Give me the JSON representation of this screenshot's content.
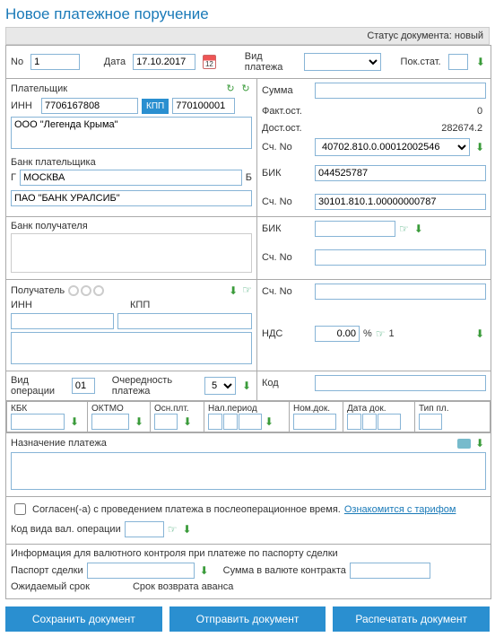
{
  "title": "Новое платежное поручение",
  "status": {
    "label": "Статус документа:",
    "value": "новый"
  },
  "header": {
    "no_label": "No",
    "no_value": "1",
    "date_label": "Дата",
    "date_value": "17.10.2017",
    "ptype_label": "Вид платежа",
    "pokstat_label": "Пок.стат."
  },
  "payer": {
    "label": "Плательщик",
    "inn_label": "ИНН",
    "inn": "7706167808",
    "kpp_btn": "КПП",
    "kpp": "770100001",
    "name": "ООО \"Легенда Крыма\"",
    "bank_label": "Банк плательщика",
    "city_label": "Г",
    "city": "МОСКВА",
    "b": "Б",
    "bank_name": "ПАО \"БАНК УРАЛСИБ\""
  },
  "recip_bank": {
    "label": "Банк получателя"
  },
  "recip": {
    "label": "Получатель",
    "inn_label": "ИНН",
    "kpp_label": "КПП"
  },
  "sum": {
    "label": "Сумма",
    "fakt_label": "Факт.ост.",
    "fakt": "0",
    "dost_label": "Дост.ост.",
    "dost": "282674.2",
    "acc_label": "Сч. No",
    "acc": "40702.810.0.00012002546",
    "bik_label": "БИК",
    "bik": "044525787",
    "acc2_label": "Сч. No",
    "acc2": "30101.810.1.00000000787"
  },
  "recip_right": {
    "bik_label": "БИК",
    "acc_label": "Сч. No",
    "acc2_label": "Сч. No"
  },
  "nds": {
    "label": "НДС",
    "value": "0.00",
    "pct": "%",
    "one": "1"
  },
  "op": {
    "label": "Вид операции",
    "value": "01",
    "queue_label": "Очередность платежа",
    "queue": "5",
    "code_label": "Код"
  },
  "cols": {
    "kbk": "КБК",
    "oktmo": "ОКТМО",
    "osn": "Осн.плт.",
    "period": "Нал.период",
    "nomdok": "Ном.док.",
    "datadok": "Дата док.",
    "tip": "Тип пл."
  },
  "purpose": {
    "label": "Назначение платежа"
  },
  "consent": {
    "text": "Согласен(-а) с проведением платежа в послеоперационное время.",
    "link": "Ознакомится с тарифом"
  },
  "valcode": {
    "label": "Код вида вал. операции"
  },
  "valinfo": {
    "label": "Информация для валютного контроля при платеже по паспорту сделки",
    "passport": "Паспорт сделки",
    "sumcontract": "Сумма в валюте контракта",
    "expected": "Ожидаемый срок",
    "advance": "Срок возврата аванса"
  },
  "buttons": {
    "save": "Сохранить документ",
    "send": "Отправить документ",
    "print": "Распечатать документ"
  }
}
